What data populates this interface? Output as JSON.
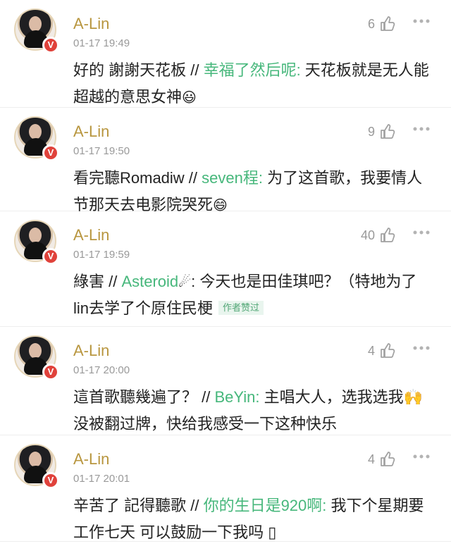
{
  "comments": [
    {
      "username": "A-Lin",
      "time": "01-17 19:49",
      "likes": "6",
      "prefix": "好的 謝謝天花板 // ",
      "mention": "幸福了然后呢:",
      "text": " 天花板就是无人能超越的意思女神",
      "emoji": "😃",
      "badge": "V"
    },
    {
      "username": "A-Lin",
      "time": "01-17 19:50",
      "likes": "9",
      "prefix": "看完聽Romadiw // ",
      "mention": "seven程:",
      "text": " 为了这首歌，我要情人节那天去电影院哭死",
      "emoji": "😄",
      "badge": "V"
    },
    {
      "username": "A-Lin",
      "time": "01-17 19:59",
      "likes": "40",
      "prefix": "綠害 // ",
      "mention": "Asteroid",
      "text": ": 今天也是田佳琪吧？（特地为了lin去学了个原住民梗",
      "emoji": "☄",
      "tag": "作者赞过",
      "badge": "V"
    },
    {
      "username": "A-Lin",
      "time": "01-17 20:00",
      "likes": "4",
      "prefix": "這首歌聽幾遍了？ // ",
      "mention": "BeYin:",
      "text": " 主唱大人，选我选我🙌没被翻过牌，快给我感受一下这种快乐",
      "emoji": "",
      "badge": "V"
    },
    {
      "username": "A-Lin",
      "time": "01-17 20:01",
      "likes": "4",
      "prefix": "辛苦了 記得聽歌 // ",
      "mention": "你的生日是920啊:",
      "text": " 我下个星期要工作七天 可以鼓励一下我吗 ▯",
      "emoji": "",
      "badge": "V"
    }
  ]
}
